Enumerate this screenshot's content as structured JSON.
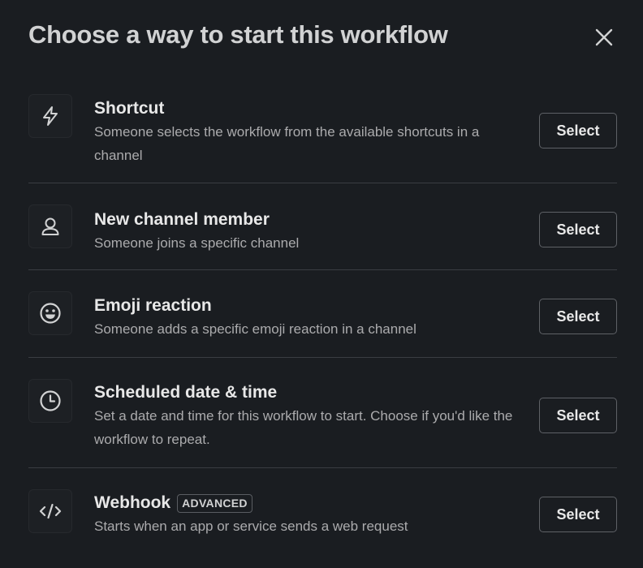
{
  "dialog": {
    "title": "Choose a way to start this workflow",
    "close_icon": "close-icon"
  },
  "options": [
    {
      "title": "Shortcut",
      "description": "Someone selects the workflow from the available shortcuts in a channel",
      "icon": "lightning-bolt-icon",
      "button_label": "Select"
    },
    {
      "title": "New channel member",
      "description": "Someone joins a specific channel",
      "icon": "person-icon",
      "button_label": "Select"
    },
    {
      "title": "Emoji reaction",
      "description": "Someone adds a specific emoji reaction in a channel",
      "icon": "emoji-smile-icon",
      "button_label": "Select"
    },
    {
      "title": "Scheduled date & time",
      "description": "Set a date and time for this workflow to start. Choose if you'd like the workflow to repeat.",
      "icon": "clock-icon",
      "button_label": "Select"
    },
    {
      "title": "Webhook",
      "badge": "ADVANCED",
      "description": "Starts when an app or service sends a web request",
      "icon": "code-icon",
      "button_label": "Select"
    }
  ],
  "colors": {
    "background": "#1a1d21",
    "text_primary": "#e8e8e8",
    "text_secondary": "#ababad",
    "divider": "#3a3d42",
    "button_border": "#5e6166"
  }
}
